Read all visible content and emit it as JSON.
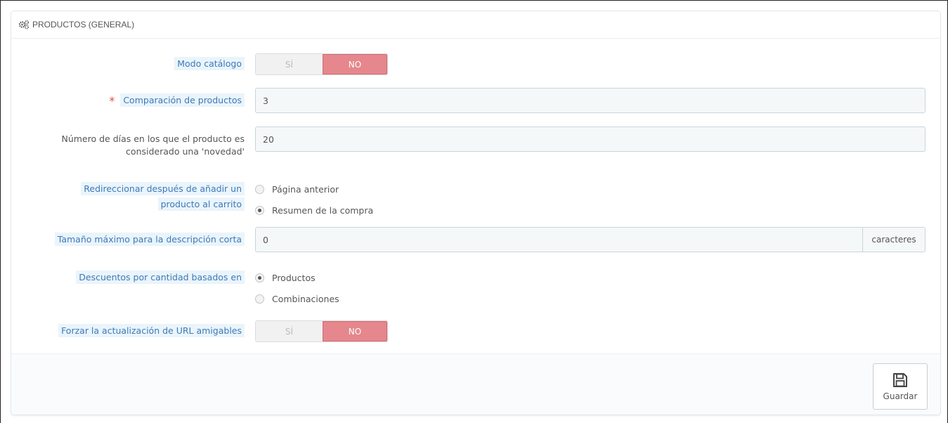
{
  "panel": {
    "title": "PRODUCTOS (GENERAL)",
    "header_icon": "cogs-icon"
  },
  "fields": {
    "catalog_mode": {
      "label": "Modo catálogo",
      "yes": "SÍ",
      "no": "NO",
      "value": "NO"
    },
    "product_comparison": {
      "required_mark": "*",
      "label": "Comparación de productos",
      "value": "3"
    },
    "new_days": {
      "label_line1": "Número de días en los que el producto es",
      "label_line2": "considerado una 'novedad'",
      "value": "20"
    },
    "redirect": {
      "label_line1": "Redireccionar después de añadir un",
      "label_line2": "producto al carrito",
      "options": [
        "Página anterior",
        "Resumen de la compra"
      ],
      "selected": "Resumen de la compra"
    },
    "short_desc": {
      "label": "Tamaño máximo para la descripción corta",
      "value": "0",
      "addon": "caracteres"
    },
    "quantity_discounts": {
      "label": "Descuentos por cantidad basados en",
      "options": [
        "Productos",
        "Combinaciones"
      ],
      "selected": "Productos"
    },
    "force_friendly_url": {
      "label": "Forzar la actualización de URL amigables",
      "yes": "SÍ",
      "no": "NO",
      "value": "NO"
    }
  },
  "footer": {
    "save_label": "Guardar",
    "save_icon": "floppy-disk-icon"
  },
  "colors": {
    "no_active": "#e5878c",
    "label_highlight_bg": "#eaf4fb",
    "label_highlight_text": "#3d7ab8",
    "required": "#e14c4c"
  }
}
